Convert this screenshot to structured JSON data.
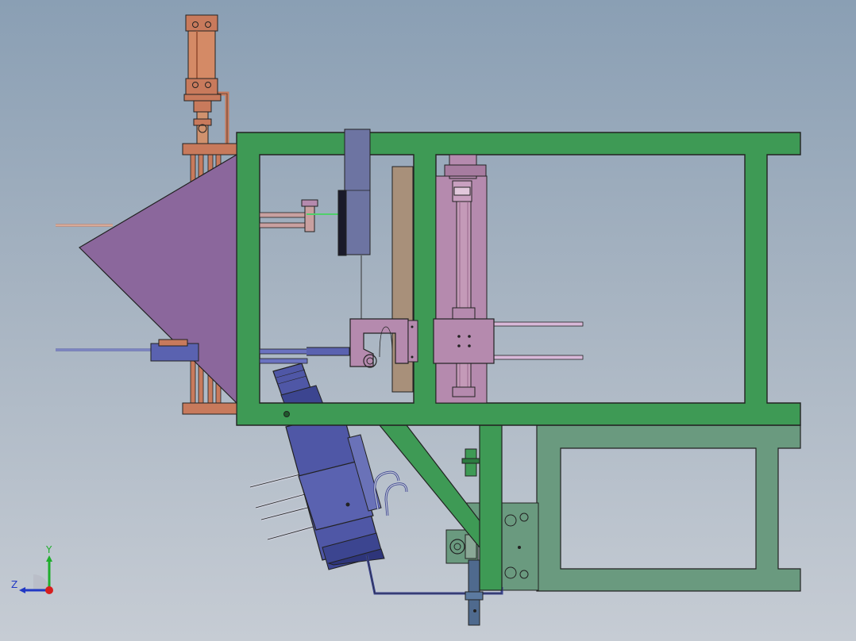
{
  "view": {
    "type": "cad-assembly-drawing",
    "projection": "side view",
    "background_gradient": [
      "#8a9fb4",
      "#c6ccd4"
    ]
  },
  "colors": {
    "frame_main": "#3e9a55",
    "frame_main_dark": "#1e5a2c",
    "frame_secondary": "#6a9a7f",
    "hopper": "#8b679c",
    "cylinder_copper": "#c87a5c",
    "vertical_actuator": "#b58aae",
    "guide_plate": "#a8907a",
    "blue_motor_unit": "#4f57a6",
    "outline": "#222222"
  },
  "axis_triad": {
    "y_label": "Y",
    "z_label": "Z",
    "y_color": "#1fae2c",
    "z_color": "#2138c4",
    "x_color": "#d61e1e"
  },
  "components": [
    {
      "name": "pneumatic-cylinder-top",
      "icon": "cylinder-icon"
    },
    {
      "name": "main-frame",
      "icon": "frame-icon"
    },
    {
      "name": "feed-hopper",
      "icon": "triangle-icon"
    },
    {
      "name": "vertical-linear-actuator",
      "icon": "actuator-icon"
    },
    {
      "name": "motor-slide-unit",
      "icon": "motor-icon"
    },
    {
      "name": "lower-extension-frame",
      "icon": "frame-icon"
    }
  ]
}
